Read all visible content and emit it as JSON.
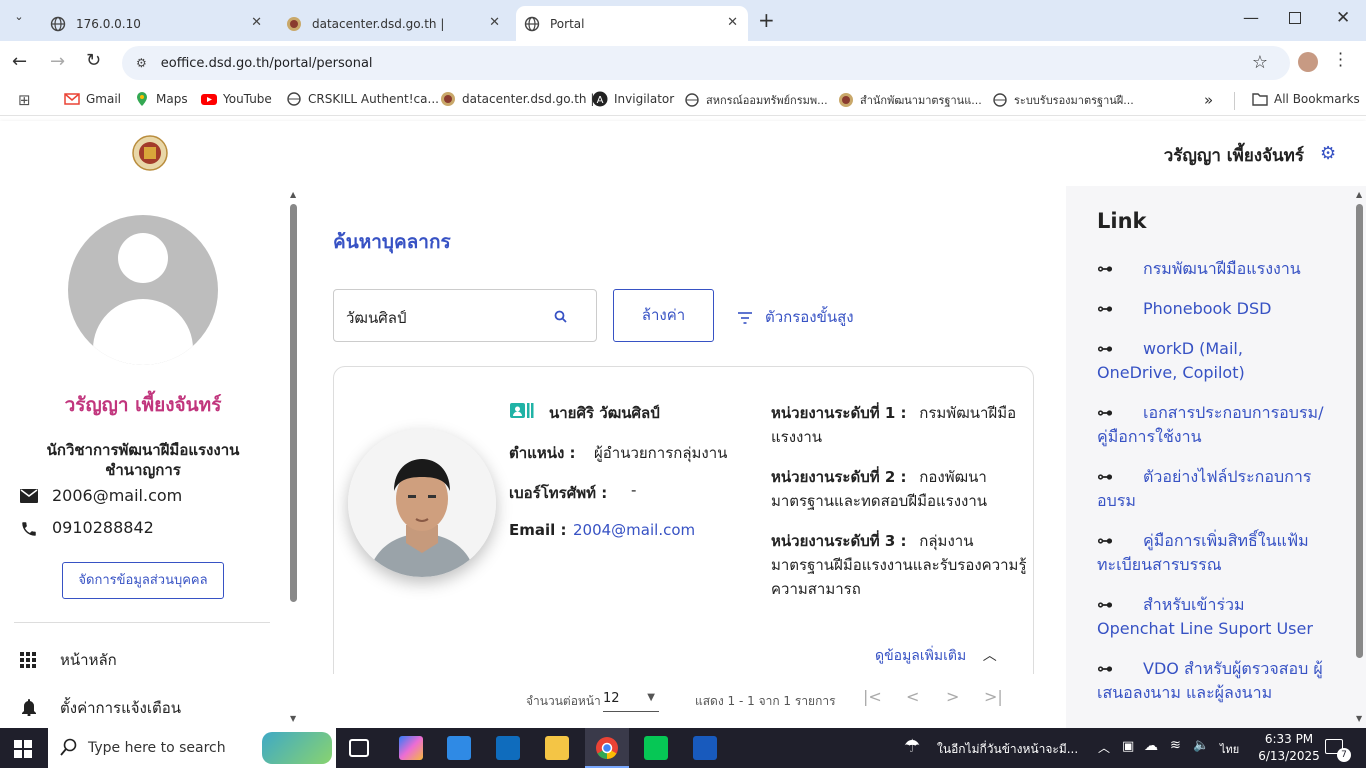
{
  "browser": {
    "tabs": [
      {
        "title": "176.0.0.10"
      },
      {
        "title": "datacenter.dsd.go.th |"
      },
      {
        "title": "Portal"
      }
    ],
    "url": "eoffice.dsd.go.th/portal/personal",
    "bookmarks": [
      {
        "label": "Gmail"
      },
      {
        "label": "Maps"
      },
      {
        "label": "YouTube"
      },
      {
        "label": "CRSKILL Authent!ca..."
      },
      {
        "label": "datacenter.dsd.go.th |"
      },
      {
        "label": "Invigilator"
      },
      {
        "label": "สหกรณ์ออมทรัพย์กรมพ..."
      },
      {
        "label": "สำนักพัฒนามาตรฐานแ..."
      },
      {
        "label": "ระบบรับรองมาตรฐานฝี..."
      }
    ],
    "all_bookmarks": "All Bookmarks"
  },
  "header": {
    "user_name": "วรัญญา เพี้ยงจันทร์"
  },
  "profile": {
    "name": "วรัญญา เพี้ยงจันทร์",
    "position_line1": "นักวิชาการพัฒนาฝีมือแรงงาน",
    "position_line2": "ชำนาญการ",
    "email": "2006@mail.com",
    "phone": "0910288842",
    "manage_button": "จัดการข้อมูลส่วนบุคคล",
    "menu": [
      {
        "label": "หน้าหลัก"
      },
      {
        "label": "ตั้งค่าการแจ้งเตือน"
      }
    ]
  },
  "search": {
    "title": "ค้นหาบุคลากร",
    "value": "วัฒนศิลป์",
    "clear_button": "ล้างค่า",
    "advanced_filter": "ตัวกรองขั้นสูง"
  },
  "result": {
    "name": "นายศิริ วัฒนศิลป์",
    "position_label": "ตำแหน่ง :",
    "position_value": "ผู้อำนวยการกลุ่มงาน",
    "phone_label": "เบอร์โทรศัพท์ :",
    "phone_value": "-",
    "email_label": "Email :",
    "email_value": "2004@mail.com",
    "unit1_label": "หน่วยงานระดับที่ 1 :",
    "unit1_value_a": "กรมพัฒนาฝีมือ",
    "unit1_value_b": "แรงงาน",
    "unit2_label": "หน่วยงานระดับที่ 2 :",
    "unit2_value_a": "กองพัฒนา",
    "unit2_value_b": "มาตรฐานและทดสอบฝีมือแรงงาน",
    "unit3_label": "หน่วยงานระดับที่ 3 :",
    "unit3_value_a": "กลุ่มงาน",
    "unit3_value_b": "มาตรฐานฝีมือแรงงานและรับรองความรู้",
    "unit3_value_c": "ความสามารถ",
    "more_info": "ดูข้อมูลเพิ่มเติม"
  },
  "pagination": {
    "per_page_label": "จำนวนต่อหน้า",
    "per_page_value": "12",
    "range_text": "แสดง 1 - 1 จาก 1 รายการ"
  },
  "links": {
    "title": "Link",
    "items": [
      {
        "label": "กรมพัฒนาฝีมือแรงงาน"
      },
      {
        "label": "Phonebook DSD"
      },
      {
        "label": "workD (Mail, OneDrive, Copilot)"
      },
      {
        "label": "เอกสารประกอบการอบรม/คู่มือการใช้งาน"
      },
      {
        "label": "ตัวอย่างไฟล์ประกอบการอบรม"
      },
      {
        "label": "คู่มือการเพิ่มสิทธิ์ในแฟ้มทะเบียนสารบรรณ"
      },
      {
        "label": "สำหรับเข้าร่วม Openchat Line Suport User"
      },
      {
        "label": "VDO สำหรับผู้ตรวจสอบ ผู้เสนอลงนาม และผู้ลงนาม"
      }
    ]
  },
  "taskbar": {
    "search_placeholder": "Type here to search",
    "weather_text": "ในอีกไม่กี่วันข้างหน้าจะมี...",
    "lang": "ไทย",
    "time": "6:33 PM",
    "date": "6/13/2025",
    "notif_count": "7"
  }
}
